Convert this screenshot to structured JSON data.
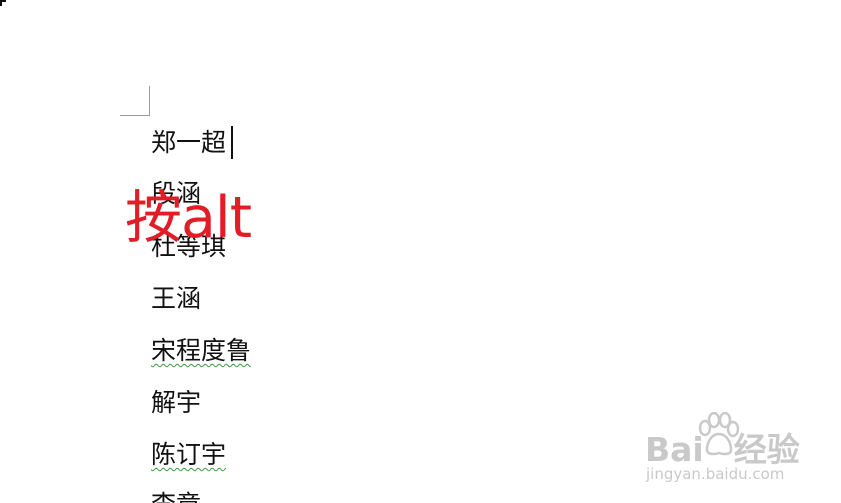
{
  "document": {
    "lines": [
      "郑一超",
      "段涵",
      "杜等琪",
      "王涵",
      "宋程度鲁",
      "解宇",
      "陈订宇",
      "李章"
    ]
  },
  "annotation": {
    "text": "按alt",
    "color": "#e31d26"
  },
  "watermark": {
    "brand_left": "Bai",
    "brand_right": "经验",
    "url": "jingyan.baidu.com"
  }
}
